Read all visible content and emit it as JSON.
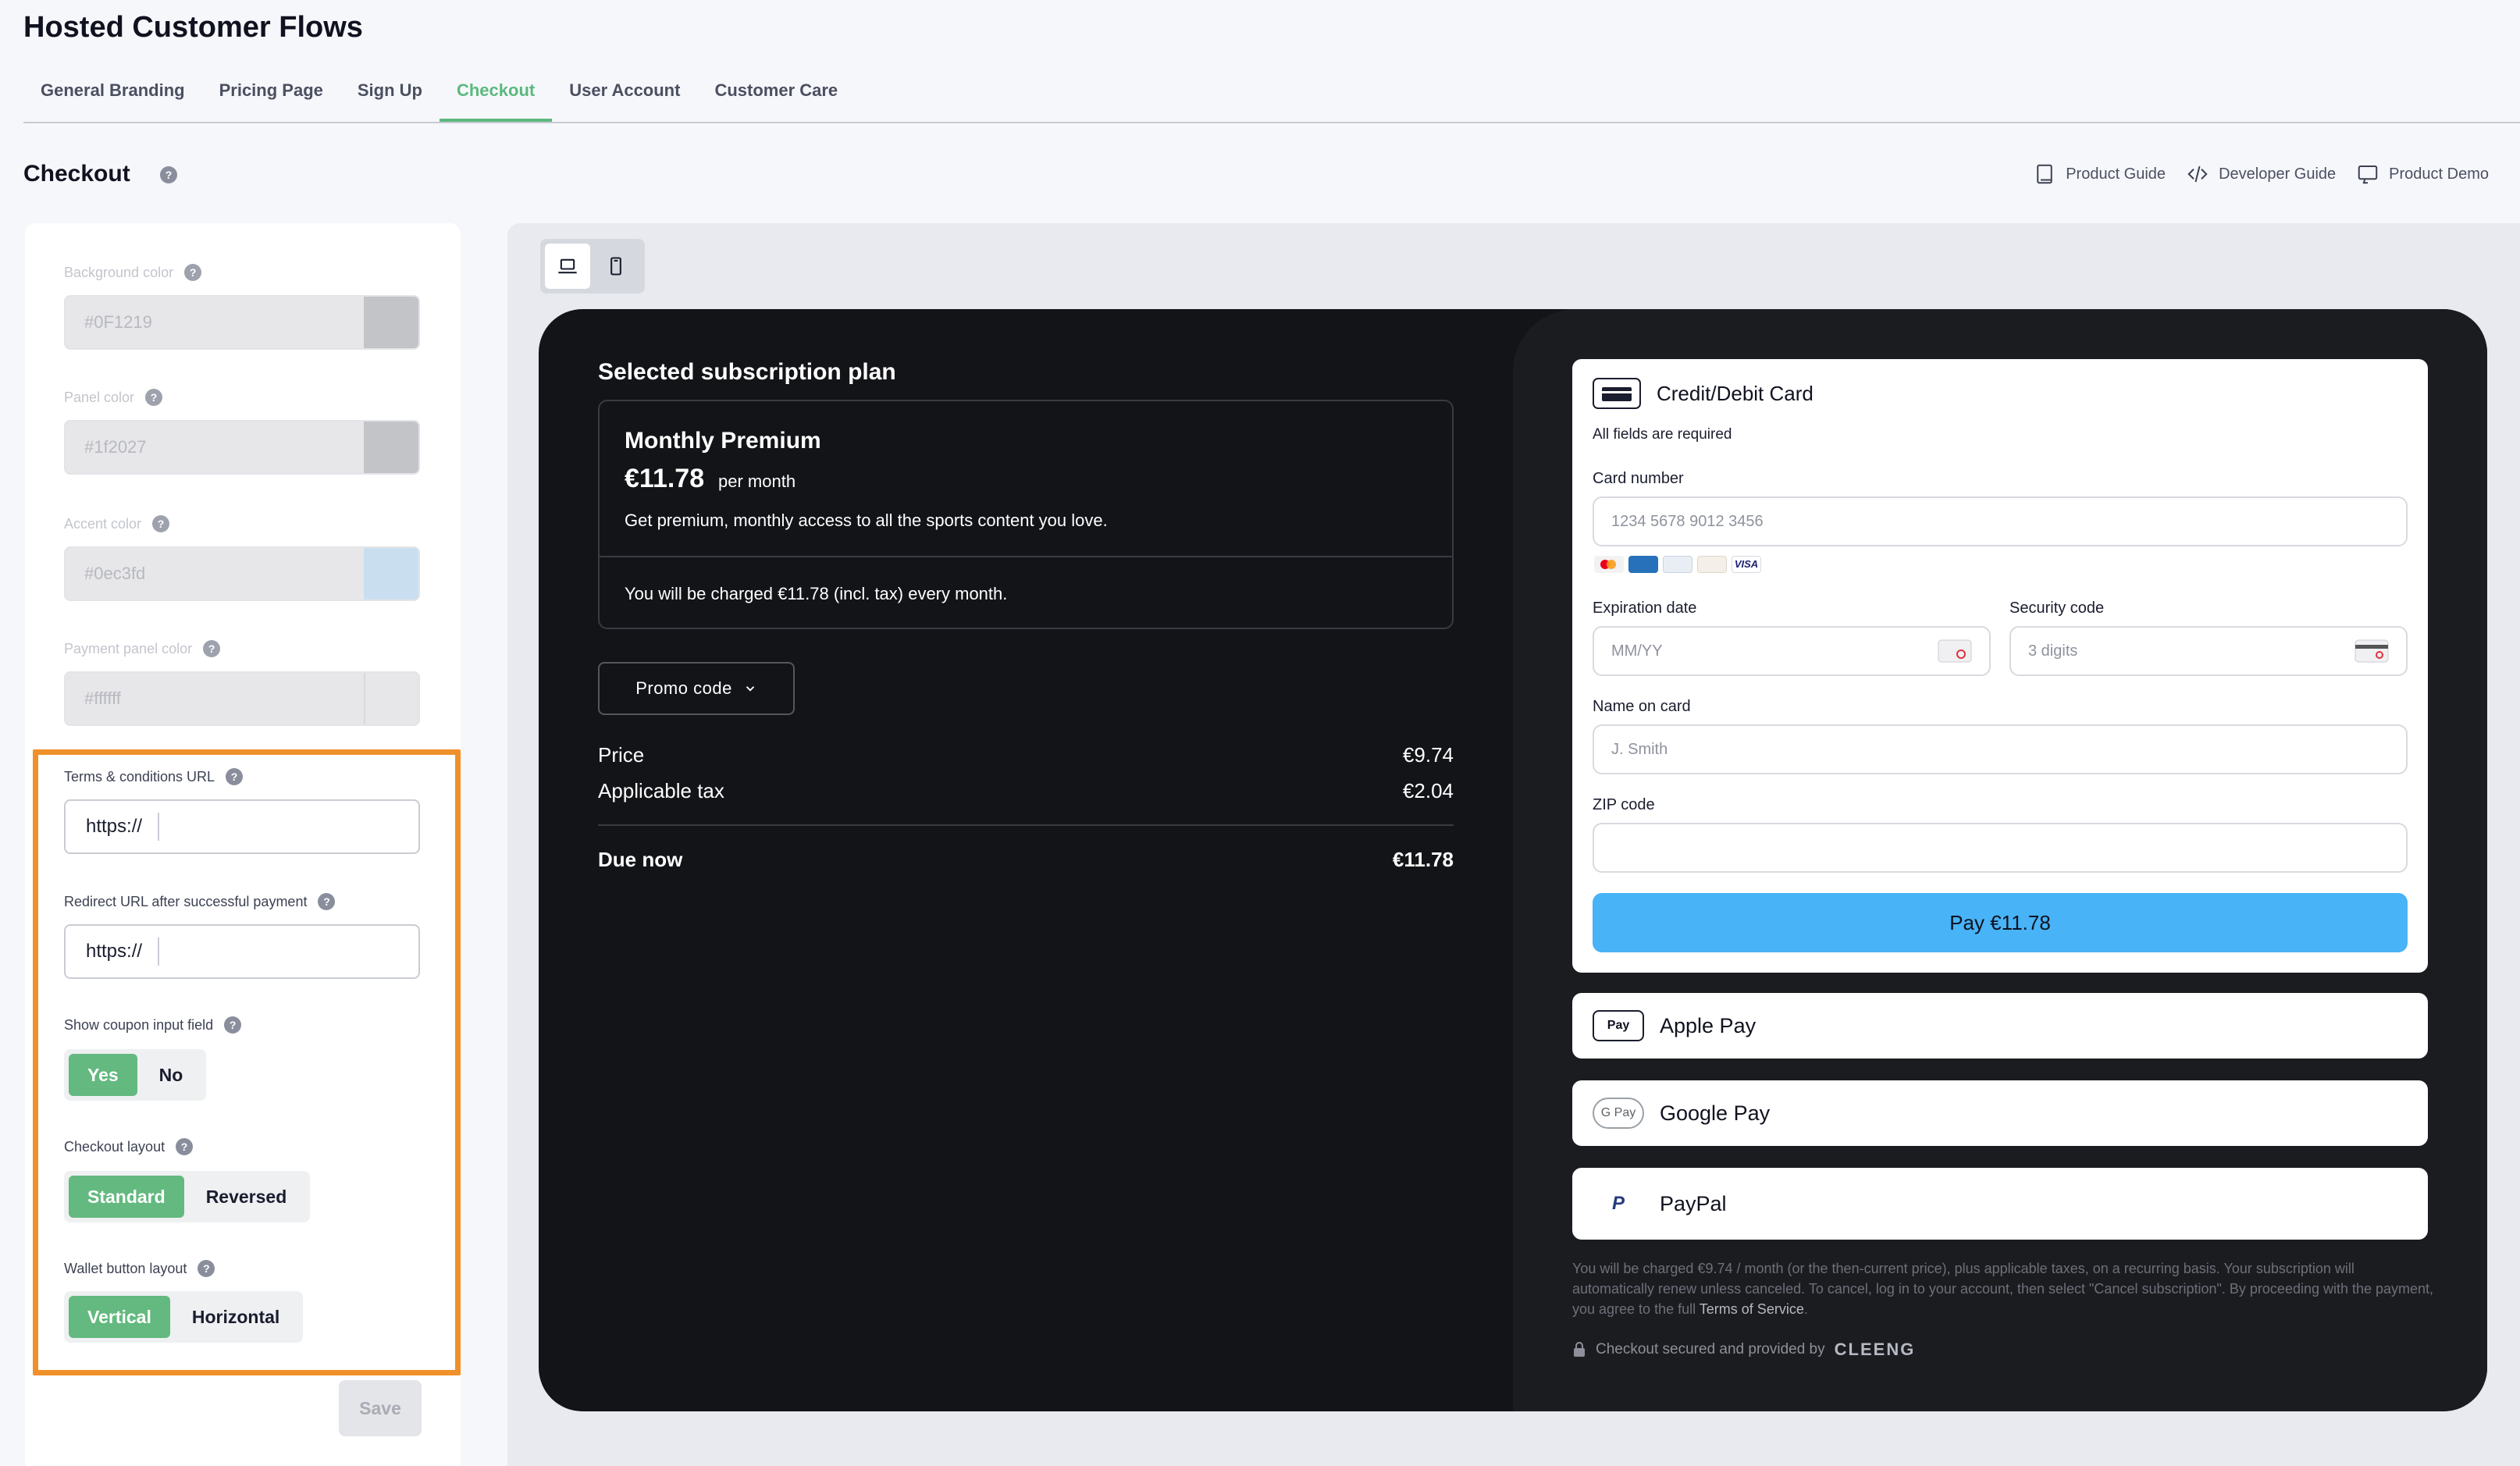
{
  "app": {
    "title": "Hosted Customer Flows"
  },
  "tabs": [
    {
      "label": "General Branding"
    },
    {
      "label": "Pricing Page"
    },
    {
      "label": "Sign Up"
    },
    {
      "label": "Checkout"
    },
    {
      "label": "User Account"
    },
    {
      "label": "Customer Care"
    }
  ],
  "page": {
    "title": "Checkout",
    "help": "?"
  },
  "guides": [
    {
      "label": "Product Guide",
      "icon": "book-icon"
    },
    {
      "label": "Developer Guide",
      "icon": "code-icon"
    },
    {
      "label": "Product Demo",
      "icon": "monitor-icon"
    }
  ],
  "settings": {
    "background": {
      "label": "Background color",
      "value": "#0F1219",
      "swatch": "#c3c4c8"
    },
    "panel": {
      "label": "Panel color",
      "value": "#1f2027",
      "swatch": "#c3c4c8"
    },
    "accent": {
      "label": "Accent color",
      "value": "#0ec3fd",
      "swatch": "#c9dff0"
    },
    "payment_panel": {
      "label": "Payment panel color",
      "value": "#ffffff",
      "swatch": "#e7e7e9"
    },
    "terms": {
      "label": "Terms & conditions URL",
      "value": "https://"
    },
    "redirect": {
      "label": "Redirect URL after successful payment",
      "value": "https://"
    },
    "coupon": {
      "label": "Show coupon input field",
      "options": [
        "Yes",
        "No"
      ],
      "selected": "Yes"
    },
    "layout": {
      "label": "Checkout layout",
      "options": [
        "Standard",
        "Reversed"
      ],
      "selected": "Standard"
    },
    "wallet": {
      "label": "Wallet button layout",
      "options": [
        "Vertical",
        "Horizontal"
      ],
      "selected": "Vertical"
    },
    "save_label": "Save"
  },
  "colors": {
    "accent_green": "#5bb97d",
    "highlight": "#f0902a",
    "pay_blue": "#48b3f7"
  },
  "preview": {
    "heading": "Selected subscription plan",
    "plan": {
      "name": "Monthly Premium",
      "price": "€11.78",
      "period": "per month",
      "description": "Get premium, monthly access to all the sports content you love.",
      "charge_note": "You will be charged €11.78 (incl. tax) every month."
    },
    "promo_label": "Promo code",
    "summary": {
      "price_label": "Price",
      "price_value": "€9.74",
      "tax_label": "Applicable tax",
      "tax_value": "€2.04",
      "due_label": "Due now",
      "due_value": "€11.78"
    },
    "card": {
      "title": "Credit/Debit Card",
      "required_note": "All fields are required",
      "number_label": "Card number",
      "number_placeholder": "1234 5678 9012 3456",
      "expiry_label": "Expiration date",
      "expiry_placeholder": "MM/YY",
      "security_label": "Security code",
      "security_placeholder": "3 digits",
      "name_label": "Name on card",
      "name_placeholder": "J. Smith",
      "zip_label": "ZIP code",
      "zip_placeholder": "",
      "pay_label": "Pay €11.78",
      "brands": [
        "mastercard",
        "amex",
        "diners",
        "discover",
        "VISA"
      ]
    },
    "wallets": [
      {
        "label": "Apple Pay",
        "icon_text": "Pay",
        "icon": "apple-pay-icon"
      },
      {
        "label": "Google Pay",
        "icon_text": "G Pay",
        "icon": "google-pay-icon"
      },
      {
        "label": "PayPal",
        "icon_text": "P",
        "icon": "paypal-icon"
      }
    ],
    "legal_text": "You will be charged €9.74 / month (or the then-current price), plus applicable taxes, on a recurring basis. Your subscription will automatically renew unless canceled. To cancel, log in to your account, then select \"Cancel subscription\". By proceeding with the payment, you agree to the full",
    "legal_link": "Terms of Service",
    "secured_text": "Checkout secured and provided by",
    "brand": "CLEENG"
  }
}
